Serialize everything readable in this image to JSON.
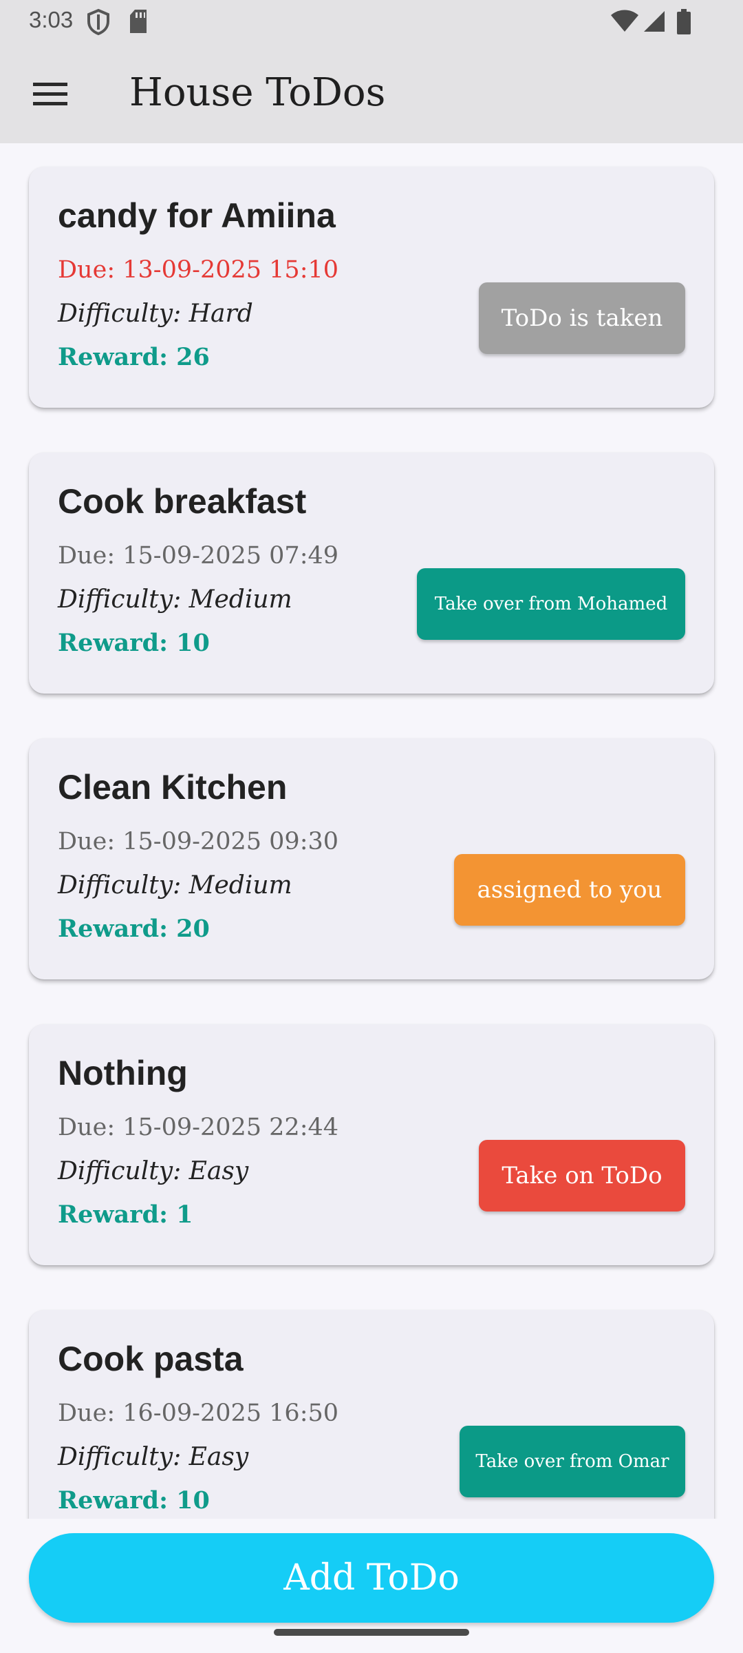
{
  "status_bar": {
    "time": "3:03",
    "left_icons": [
      "shield-icon",
      "sd-card-icon"
    ],
    "right_icons": [
      "wifi-icon",
      "signal-icon",
      "battery-icon"
    ]
  },
  "app_bar": {
    "title": "House ToDos",
    "menu_icon": "hamburger-menu-icon"
  },
  "todos": [
    {
      "title": "candy for Amiina",
      "due": "Due: 13-09-2025 15:10",
      "overdue": true,
      "difficulty": "Difficulty: Hard",
      "reward": "Reward: 26",
      "action_label": "ToDo is taken",
      "action_color": "#a1a1a1"
    },
    {
      "title": "Cook breakfast",
      "due": "Due: 15-09-2025 07:49",
      "overdue": false,
      "difficulty": "Difficulty: Medium",
      "reward": "Reward: 10",
      "action_label": "Take over from Mohamed",
      "action_color": "#0b9a87"
    },
    {
      "title": "Clean Kitchen",
      "due": "Due: 15-09-2025 09:30",
      "overdue": false,
      "difficulty": "Difficulty: Medium",
      "reward": "Reward: 20",
      "action_label": "assigned to you",
      "action_color": "#f39433"
    },
    {
      "title": "Nothing",
      "due": "Due: 15-09-2025 22:44",
      "overdue": false,
      "difficulty": "Difficulty: Easy",
      "reward": "Reward: 1",
      "action_label": "Take on ToDo",
      "action_color": "#ea4a3d"
    },
    {
      "title": "Cook pasta",
      "due": "Due: 16-09-2025 16:50",
      "overdue": false,
      "difficulty": "Difficulty: Easy",
      "reward": "Reward: 10",
      "action_label": "Take over from Omar",
      "action_color": "#0b9a87"
    }
  ],
  "add_button": {
    "label": "Add ToDo",
    "color": "#15cdf6"
  }
}
